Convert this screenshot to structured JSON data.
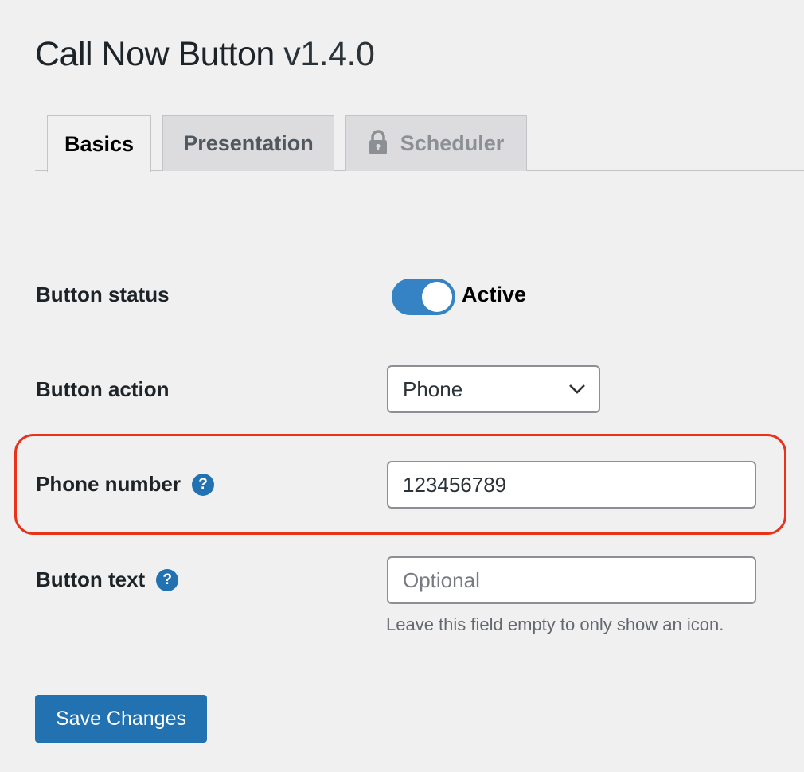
{
  "header": {
    "title": "Call Now Button",
    "version": "v1.4.0"
  },
  "tabs": [
    {
      "label": "Basics",
      "active": true,
      "locked": false
    },
    {
      "label": "Presentation",
      "active": false,
      "locked": false
    },
    {
      "label": "Scheduler",
      "active": false,
      "locked": true,
      "icon": "lock-icon"
    }
  ],
  "form": {
    "button_status": {
      "label": "Button status",
      "toggle_on": true,
      "toggle_label": "Active"
    },
    "button_action": {
      "label": "Button action",
      "selected": "Phone"
    },
    "phone_number": {
      "label": "Phone number",
      "help_icon": "?",
      "value": "123456789",
      "highlighted": true,
      "highlight_color": "#e8321c"
    },
    "button_text": {
      "label": "Button text",
      "help_icon": "?",
      "value": "",
      "placeholder": "Optional",
      "description": "Leave this field empty to only show an icon."
    }
  },
  "actions": {
    "save_label": "Save Changes"
  },
  "colors": {
    "accent": "#2271b1",
    "toggle": "#3582c4",
    "background": "#f0f0f1"
  }
}
